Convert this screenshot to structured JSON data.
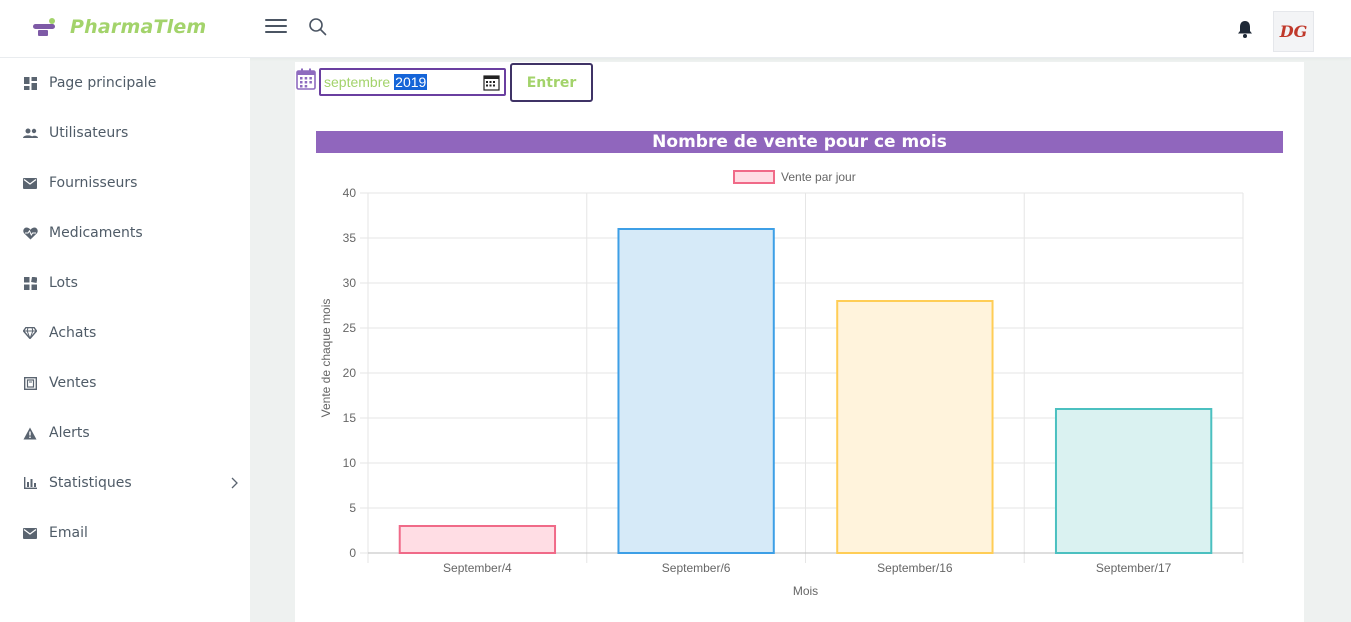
{
  "app": {
    "brand_name": "PharmaTlem",
    "avatar_initials": "DG",
    "brand_color": "#a3d36b",
    "accent_color": "#9066bd"
  },
  "header": {
    "menu_icon": "hamburger-icon",
    "search_icon": "search-icon",
    "notification_icon": "bell-icon"
  },
  "sidebar": {
    "items": [
      {
        "label": "Page principale",
        "icon": "dashboard-icon"
      },
      {
        "label": "Utilisateurs",
        "icon": "users-icon"
      },
      {
        "label": "Fournisseurs",
        "icon": "mail-icon"
      },
      {
        "label": "Medicaments",
        "icon": "heart-pulse-icon"
      },
      {
        "label": "Lots",
        "icon": "boxes-icon"
      },
      {
        "label": "Achats",
        "icon": "diamond-icon"
      },
      {
        "label": "Ventes",
        "icon": "register-icon"
      },
      {
        "label": "Alerts",
        "icon": "warning-icon"
      },
      {
        "label": "Statistiques",
        "icon": "bar-chart-icon",
        "has_submenu": true
      },
      {
        "label": "Email",
        "icon": "mail-icon"
      }
    ]
  },
  "filter": {
    "month_value": "septembre",
    "year_value": "2019",
    "submit_label": "Entrer"
  },
  "chart_section": {
    "title": "Nombre de vente pour ce mois"
  },
  "chart_data": {
    "type": "bar",
    "categories": [
      "September/4",
      "September/6",
      "September/16",
      "September/17"
    ],
    "series": [
      {
        "name": "Vente par jour",
        "values": [
          3,
          36,
          28,
          16
        ]
      }
    ],
    "bar_fill_colors": [
      "#ffdde4",
      "#d6eaf8",
      "#fff3dc",
      "#daf2f1"
    ],
    "bar_border_colors": [
      "#f06a88",
      "#3d9fe6",
      "#ffcd56",
      "#4bc0c0"
    ],
    "xlabel": "Mois",
    "ylabel": "Vente de chaque mois",
    "ylim": [
      0,
      40
    ],
    "yticks": [
      0,
      5,
      10,
      15,
      20,
      25,
      30,
      35,
      40
    ],
    "grid": true,
    "legend_position": "top-center"
  }
}
